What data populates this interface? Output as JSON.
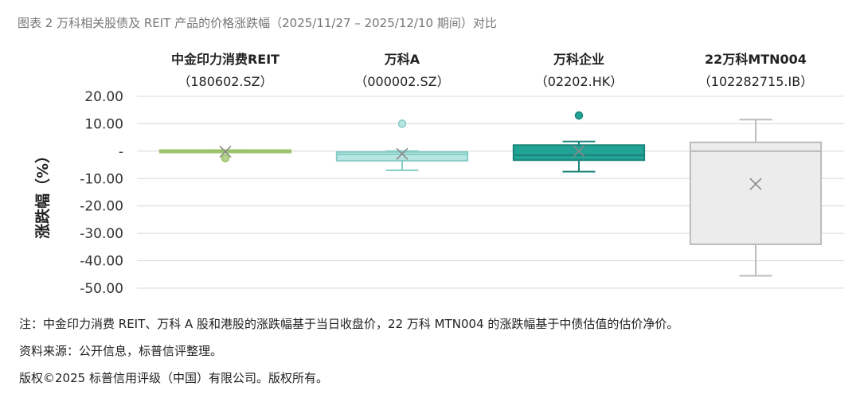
{
  "figure": {
    "title": "图表 2 万科相关股债及 REIT 产品的价格涨跌幅（2025/11/27 – 2025/12/10 期间）对比",
    "notes": [
      "注：中金印力消费 REIT、万科 A 股和港股的涨跌幅基于当日收盘价，22 万科 MTN004 的涨跌幅基于中债估值的估价净价。",
      "资料来源：公开信息，标普信评整理。",
      "版权©2025 标普信用评级（中国）有限公司。版权所有。"
    ]
  },
  "chart_data": {
    "type": "boxplot",
    "ylabel": "涨跌幅（%）",
    "ylim": [
      -50,
      20
    ],
    "yticks": [
      {
        "value": 20,
        "label": "20.00"
      },
      {
        "value": 10,
        "label": "10.00"
      },
      {
        "value": 0,
        "label": "-"
      },
      {
        "value": -10,
        "label": "-10.00"
      },
      {
        "value": -20,
        "label": "-20.00"
      },
      {
        "value": -30,
        "label": "-30.00"
      },
      {
        "value": -40,
        "label": "-40.00"
      },
      {
        "value": -50,
        "label": "-50.00"
      }
    ],
    "grid": true,
    "legend": "none",
    "series": [
      {
        "name_line1": "中金印力消费REIT",
        "name_line2": "（180602.SZ）",
        "whisker_low": -0.3,
        "q1": -0.5,
        "median": -0.2,
        "q3": 0.0,
        "whisker_high": 0.3,
        "mean": -0.2,
        "outliers": [
          -2.6
        ],
        "fill": "#b3d28c",
        "stroke": "#9cc26a"
      },
      {
        "name_line1": "万科A",
        "name_line2": "（000002.SZ）",
        "whisker_low": -7.0,
        "q1": -3.5,
        "median": -1.2,
        "q3": -0.3,
        "whisker_high": 0.0,
        "mean": -1.0,
        "outliers": [
          10.0
        ],
        "fill": "#b8e6e2",
        "stroke": "#86cdc6"
      },
      {
        "name_line1": "万科企业",
        "name_line2": "（02202.HK）",
        "whisker_low": -7.5,
        "q1": -3.3,
        "median": -1.5,
        "q3": 2.2,
        "whisker_high": 3.5,
        "mean": 0.0,
        "outliers": [
          13.0
        ],
        "fill": "#21a396",
        "stroke": "#1a8479"
      },
      {
        "name_line1": "22万科MTN004",
        "name_line2": "（102282715.IB）",
        "whisker_low": -45.5,
        "q1": -34.0,
        "median": 0.0,
        "q3": 3.2,
        "whisker_high": 11.5,
        "mean": -12.0,
        "outliers": [],
        "fill": "#ececec",
        "stroke": "#bbbbbb"
      }
    ]
  }
}
